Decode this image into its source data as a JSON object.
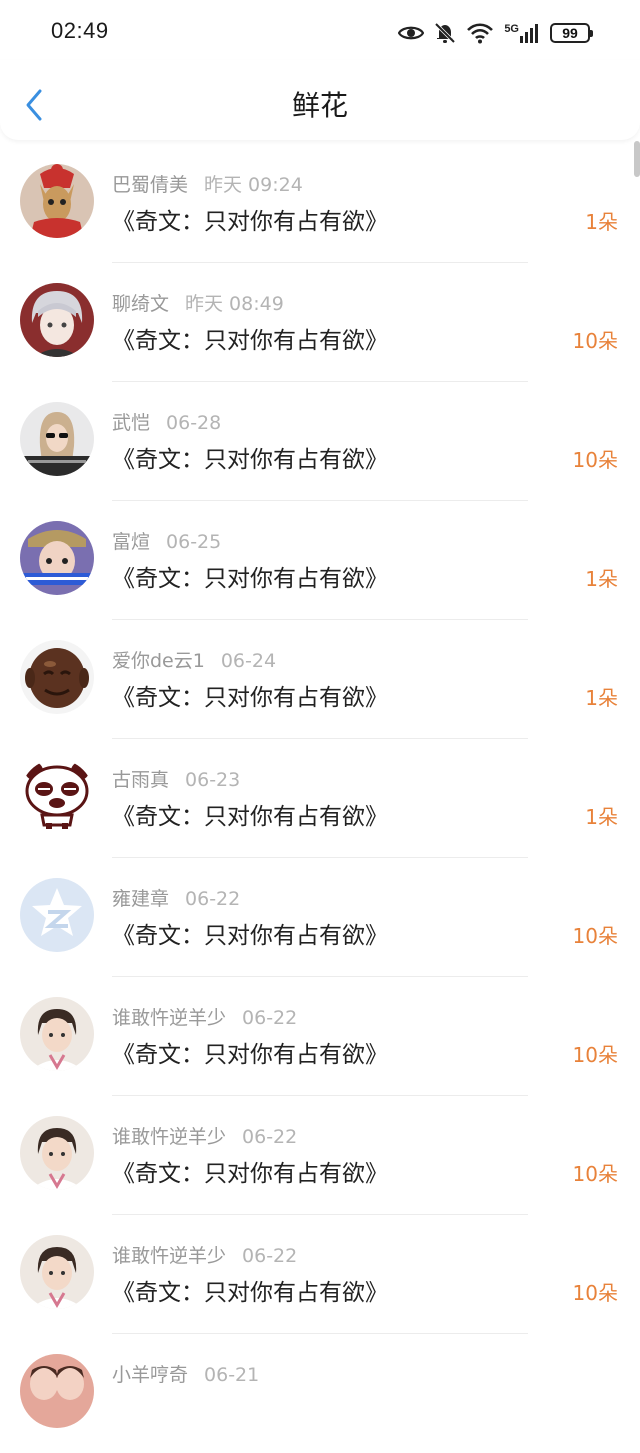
{
  "status": {
    "time": "02:49",
    "battery": "99",
    "network": "5G"
  },
  "header": {
    "title": "鲜花"
  },
  "items": [
    {
      "name": "巴蜀倩美",
      "date": "昨天 09:24",
      "book": "《奇文：只对你有占有欲》",
      "count": "1朵",
      "avatar": "dog-avatar"
    },
    {
      "name": "聊绮文",
      "date": "昨天 08:49",
      "book": "《奇文：只对你有占有欲》",
      "count": "10朵",
      "avatar": "anime-avatar"
    },
    {
      "name": "武恺",
      "date": "06-28",
      "book": "《奇文：只对你有占有欲》",
      "count": "10朵",
      "avatar": "girl-avatar"
    },
    {
      "name": "富煊",
      "date": "06-25",
      "book": "《奇文：只对你有占有欲》",
      "count": "1朵",
      "avatar": "boy-avatar"
    },
    {
      "name": "爱你de云1",
      "date": "06-24",
      "book": "《奇文：只对你有占有欲》",
      "count": "1朵",
      "avatar": "buddha-avatar"
    },
    {
      "name": "古雨真",
      "date": "06-23",
      "book": "《奇文：只对你有占有欲》",
      "count": "1朵",
      "avatar": "panda-avatar"
    },
    {
      "name": "雍建章",
      "date": "06-22",
      "book": "《奇文：只对你有占有欲》",
      "count": "10朵",
      "avatar": "default-avatar"
    },
    {
      "name": "谁敢忤逆羊少",
      "date": "06-22",
      "book": "《奇文：只对你有占有欲》",
      "count": "10朵",
      "avatar": "student-avatar"
    },
    {
      "name": "谁敢忤逆羊少",
      "date": "06-22",
      "book": "《奇文：只对你有占有欲》",
      "count": "10朵",
      "avatar": "student-avatar"
    },
    {
      "name": "谁敢忤逆羊少",
      "date": "06-22",
      "book": "《奇文：只对你有占有欲》",
      "count": "10朵",
      "avatar": "student-avatar"
    },
    {
      "name": "小羊哼奇",
      "date": "06-21",
      "book": "",
      "count": "",
      "avatar": "couple-avatar"
    }
  ],
  "colors": {
    "accent": "#e8823a",
    "back": "#3a8fe0"
  }
}
